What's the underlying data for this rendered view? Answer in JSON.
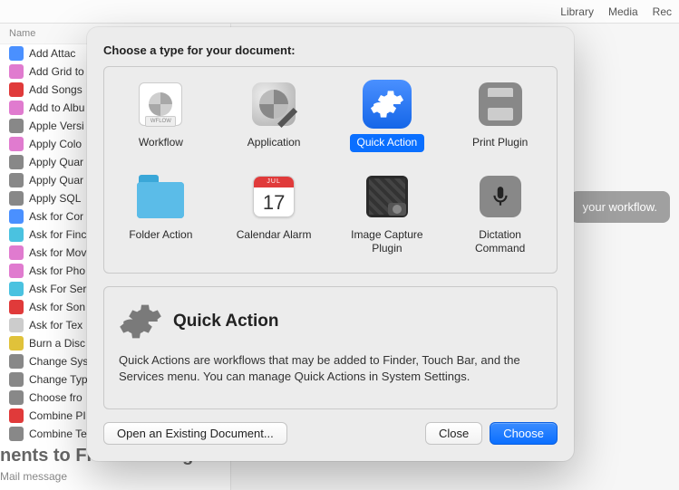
{
  "toolbar": {
    "library": "Library",
    "media": "Media",
    "rec": "Rec"
  },
  "sidebar_header": "Name",
  "sidebar_items": [
    "Add Attac",
    "Add Grid to",
    "Add Songs",
    "Add to Albu",
    "Apple Versi",
    "Apply Colo",
    "Apply Quar",
    "Apply Quar",
    "Apply SQL",
    "Ask for Cor",
    "Ask for Finc",
    "Ask for Mov",
    "Ask for Pho",
    "Ask For Ser",
    "Ask for Son",
    "Ask for Tex",
    "Burn a Disc",
    "Change Sys",
    "Change Typ",
    "Choose fro",
    "Combine PI",
    "Combine Te"
  ],
  "canvas_hint": "your workflow.",
  "big_title": "nents to Front Message",
  "big_sub": "Mail message",
  "modal": {
    "title": "Choose a type for your document:",
    "types": [
      {
        "label": "Workflow"
      },
      {
        "label": "Application"
      },
      {
        "label": "Quick Action"
      },
      {
        "label": "Print Plugin"
      },
      {
        "label": "Folder Action"
      },
      {
        "label": "Calendar Alarm"
      },
      {
        "label": "Image Capture Plugin"
      },
      {
        "label": "Dictation Command"
      }
    ],
    "selected_index": 2,
    "calendar_month": "JUL",
    "calendar_day": "17",
    "workflow_tag": "WFLOW",
    "desc_title": "Quick Action",
    "desc_text": "Quick Actions are workflows that may be added to Finder, Touch Bar, and the Services menu. You can manage Quick Actions in System Settings.",
    "open_existing": "Open an Existing Document...",
    "close": "Close",
    "choose": "Choose"
  }
}
